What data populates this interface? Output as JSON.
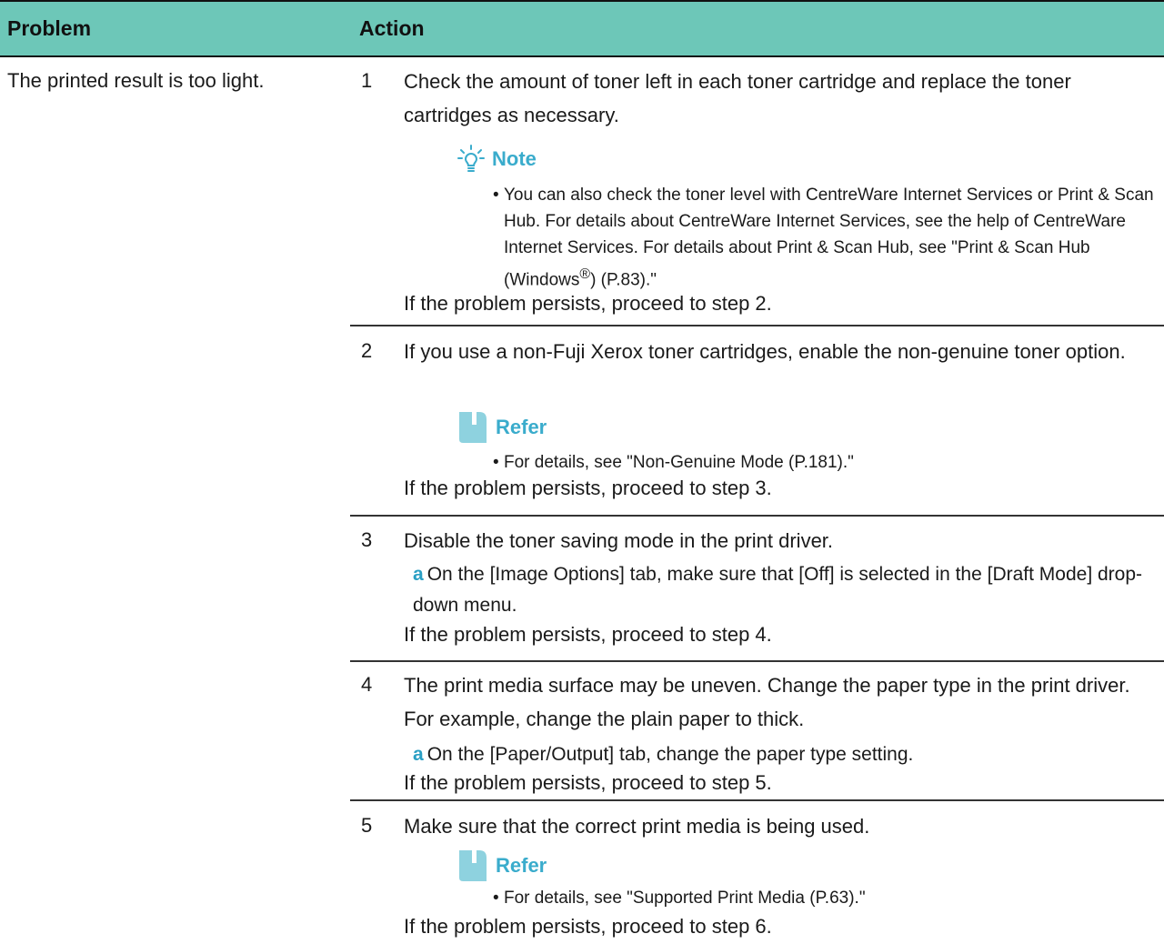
{
  "header": {
    "problem": "Problem",
    "action": "Action"
  },
  "problem_text": "The printed result is too light.",
  "steps": [
    {
      "number": "1",
      "text": "Check the amount of toner left in each toner cartridge and replace the toner cartridges as necessary.",
      "note": {
        "heading": "Note",
        "bullet_part1": "You can also check the toner level with CentreWare Internet Services or Print & Scan Hub. For details about CentreWare Internet Services, see the help of CentreWare Internet Services. For details about Print & Scan Hub, see \"Print & Scan Hub (Windows",
        "bullet_sup": "®",
        "bullet_part2": ") (P.83).\""
      },
      "persist": "If the problem persists, proceed to step 2."
    },
    {
      "number": "2",
      "text": "If you use a non-Fuji Xerox toner cartridges, enable the non-genuine toner option.",
      "refer": {
        "heading": "Refer",
        "bullet": "For details, see \"Non-Genuine Mode (P.181).\""
      },
      "persist": "If the problem persists, proceed to step 3."
    },
    {
      "number": "3",
      "text": "Disable the toner saving mode in the print driver.",
      "sub": {
        "letter": "a",
        "text": "On the [Image Options] tab, make sure that [Off] is selected in the [Draft Mode] drop-down menu."
      },
      "persist": "If the problem persists, proceed to step 4."
    },
    {
      "number": "4",
      "text": "The print media surface may be uneven. Change the paper type in the print driver. For example, change the plain paper to thick.",
      "sub": {
        "letter": "a",
        "text": "On the [Paper/Output] tab, change the paper type setting."
      },
      "persist": "If the problem persists, proceed to step 5."
    },
    {
      "number": "5",
      "text": "Make sure that the correct print media is being used.",
      "refer": {
        "heading": "Refer",
        "bullet": "For details, see \"Supported Print Media (P.63).\""
      },
      "persist": "If the problem persists, proceed to step 6."
    }
  ]
}
